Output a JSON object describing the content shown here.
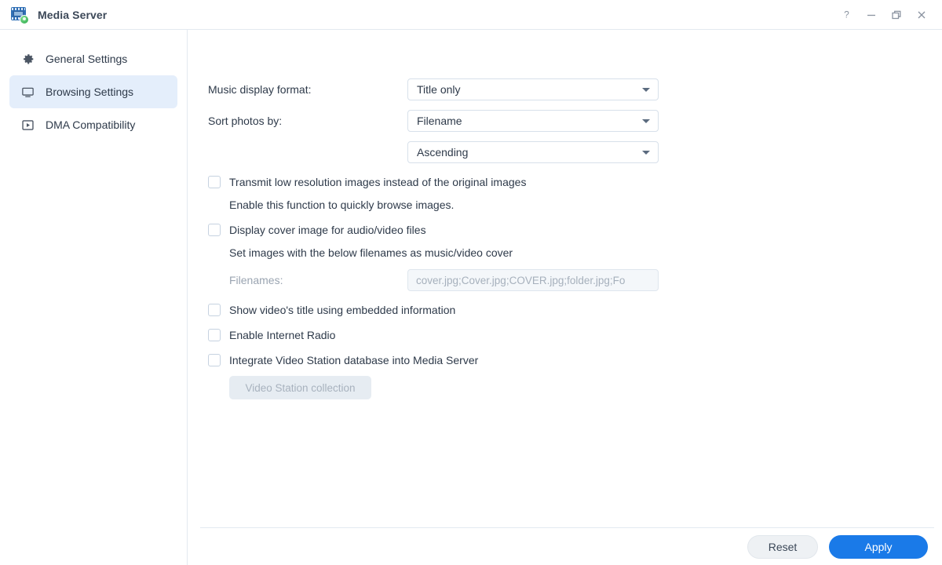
{
  "window": {
    "title": "Media Server",
    "app_icon": "media-server-icon",
    "controls": [
      {
        "name": "help-button",
        "glyph": "?"
      },
      {
        "name": "minimize-button",
        "glyph": "–"
      },
      {
        "name": "restore-button",
        "glyph": "❐"
      },
      {
        "name": "close-button",
        "glyph": "✕"
      }
    ]
  },
  "sidebar": {
    "items": [
      {
        "label": "General Settings",
        "icon": "gear-icon",
        "selected": false
      },
      {
        "label": "Browsing Settings",
        "icon": "monitor-icon",
        "selected": true
      },
      {
        "label": "DMA Compatibility",
        "icon": "play-box-icon",
        "selected": false
      }
    ]
  },
  "main": {
    "music_display_format": {
      "label": "Music display format:",
      "value": "Title only"
    },
    "sort_photos_by": {
      "label": "Sort photos by:",
      "value": "Filename"
    },
    "sort_order": {
      "value": "Ascending"
    },
    "transmit_low_res": {
      "label": "Transmit low resolution images instead of the original images",
      "checked": false,
      "note": "Enable this function to quickly browse images."
    },
    "display_cover_image": {
      "label": "Display cover image for audio/video files",
      "checked": false,
      "note": "Set images with the below filenames as music/video cover"
    },
    "filenames": {
      "label": "Filenames:",
      "value": "cover.jpg;Cover.jpg;COVER.jpg;folder.jpg;Fo",
      "disabled": true
    },
    "show_video_title": {
      "label": "Show video's title using embedded information",
      "checked": false
    },
    "enable_internet_radio": {
      "label": "Enable Internet Radio",
      "checked": false
    },
    "integrate_video_station": {
      "label": "Integrate Video Station database into Media Server",
      "checked": false
    },
    "video_station_collection_button": {
      "label": "Video Station collection",
      "disabled": true
    }
  },
  "footer": {
    "reset_label": "Reset",
    "apply_label": "Apply"
  },
  "colors": {
    "accent": "#1a7ae8",
    "sidebar_selected": "#e4eefb",
    "border": "#e3e9f0",
    "text": "#2e3a4a",
    "muted_text": "#a6b0bc"
  }
}
